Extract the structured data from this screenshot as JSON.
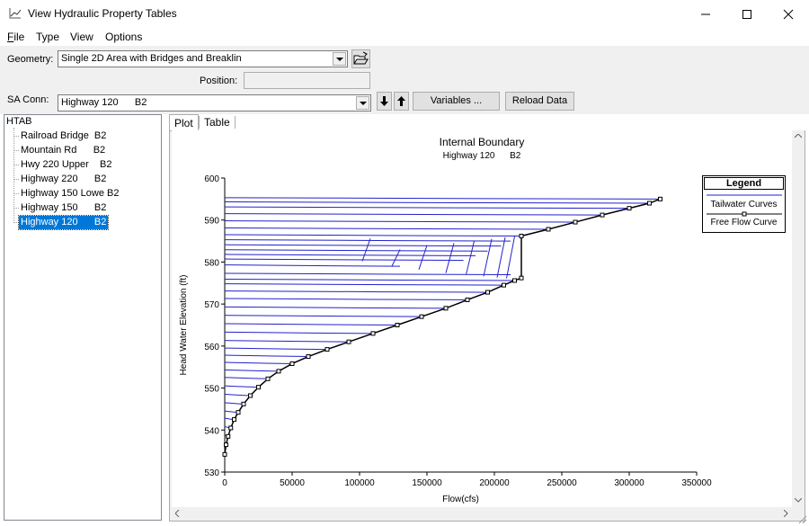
{
  "window": {
    "title": "View Hydraulic Property Tables",
    "icons": [
      "app-chart-icon",
      "minimize-icon",
      "maximize-icon",
      "close-icon"
    ]
  },
  "menu": {
    "file": {
      "u": "F",
      "rest": "ile"
    },
    "type": "Type",
    "view": "View",
    "options": "Options"
  },
  "toolbar": {
    "geometry_label": "Geometry:",
    "geometry_value": "Single 2D Area with Bridges and Breaklin",
    "position_label": "Position:",
    "position_value": "",
    "saconn_label": "SA Conn:",
    "saconn_value": "Highway 120      B2",
    "variables_button": "Variables ...",
    "reload_button": "Reload Data",
    "icons": [
      "open-folder-icon",
      "down-arrow-icon",
      "up-arrow-icon"
    ]
  },
  "tree": {
    "root": "HTAB",
    "items": [
      {
        "label": "Railroad Bridge  B2",
        "selected": false
      },
      {
        "label": "Mountain Rd      B2",
        "selected": false
      },
      {
        "label": "Hwy 220 Upper    B2",
        "selected": false
      },
      {
        "label": "Highway 220      B2",
        "selected": false
      },
      {
        "label": "Highway 150 Lowe B2",
        "selected": false
      },
      {
        "label": "Highway 150      B2",
        "selected": false
      },
      {
        "label": "Highway 120      B2",
        "selected": true
      }
    ]
  },
  "tabs": [
    {
      "label": "Plot",
      "active": true
    },
    {
      "label": "Table",
      "active": false
    }
  ],
  "chart_data": {
    "type": "line",
    "title": "Internal Boundary",
    "subtitle": "Highway 120      B2",
    "xlabel": "Flow(cfs)",
    "ylabel": "Head Water Elevation (ft)",
    "xlim": [
      0,
      350000
    ],
    "ylim": [
      530,
      600
    ],
    "xticks": [
      "0",
      "50000",
      "100000",
      "150000",
      "200000",
      "250000",
      "300000",
      "350000"
    ],
    "yticks": [
      "530",
      "540",
      "550",
      "560",
      "570",
      "580",
      "590",
      "600"
    ],
    "legend_position": "top-right",
    "legend_title": "Legend",
    "colors": {
      "tailwater": "#2222cc",
      "freeflow": "#000000"
    },
    "series": [
      {
        "name": "Free Flow Curve",
        "points": [
          [
            0,
            534.2
          ],
          [
            1000,
            536.5
          ],
          [
            2500,
            538.5
          ],
          [
            4500,
            540.5
          ],
          [
            7000,
            542.5
          ],
          [
            10000,
            544.2
          ],
          [
            14000,
            546.2
          ],
          [
            19000,
            548.2
          ],
          [
            25000,
            550.2
          ],
          [
            32000,
            552.2
          ],
          [
            40000,
            554.0
          ],
          [
            50000,
            555.8
          ],
          [
            62000,
            557.5
          ],
          [
            76000,
            559.2
          ],
          [
            92000,
            561.0
          ],
          [
            110000,
            563.0
          ],
          [
            128000,
            565.0
          ],
          [
            146000,
            567.0
          ],
          [
            164000,
            569.0
          ],
          [
            180000,
            571.0
          ],
          [
            195000,
            572.8
          ],
          [
            207000,
            574.5
          ],
          [
            215000,
            575.6
          ],
          [
            220000,
            576.2
          ],
          [
            220000,
            586.2
          ],
          [
            240000,
            587.8
          ],
          [
            260000,
            589.5
          ],
          [
            280000,
            591.2
          ],
          [
            300000,
            592.8
          ],
          [
            315000,
            594.0
          ],
          [
            323000,
            595.0
          ]
        ]
      },
      {
        "name": "Tailwater Curves",
        "curves": [
          {
            "head": 595.0,
            "x0": 0,
            "x1": 323000
          },
          {
            "head": 594.0,
            "x0": 0,
            "x1": 315000
          },
          {
            "head": 592.8,
            "x0": 0,
            "x1": 300000
          },
          {
            "head": 591.2,
            "x0": 0,
            "x1": 280000
          },
          {
            "head": 589.5,
            "x0": 0,
            "x1": 260000
          },
          {
            "head": 587.8,
            "x0": 0,
            "x1": 240000
          },
          {
            "head": 586.2,
            "x0": 0,
            "x1": 220000
          },
          {
            "head": 585.0,
            "x0": 0,
            "x1": 212000
          },
          {
            "head": 583.8,
            "x0": 0,
            "x1": 205000
          },
          {
            "head": 582.6,
            "x0": 0,
            "x1": 195000
          },
          {
            "head": 581.5,
            "x0": 0,
            "x1": 186000
          },
          {
            "head": 580.4,
            "x0": 0,
            "x1": 177000
          },
          {
            "head": 579.0,
            "x0": 0,
            "x1": 130000
          },
          {
            "head": 577.0,
            "x0": 0,
            "x1": 212000
          },
          {
            "head": 575.6,
            "x0": 0,
            "x1": 215000
          },
          {
            "head": 574.5,
            "x0": 0,
            "x1": 207000
          },
          {
            "head": 572.8,
            "x0": 0,
            "x1": 195000
          },
          {
            "head": 571.0,
            "x0": 0,
            "x1": 180000
          },
          {
            "head": 569.0,
            "x0": 0,
            "x1": 164000
          },
          {
            "head": 567.0,
            "x0": 0,
            "x1": 146000
          },
          {
            "head": 565.0,
            "x0": 0,
            "x1": 128000
          },
          {
            "head": 563.0,
            "x0": 0,
            "x1": 110000
          },
          {
            "head": 561.0,
            "x0": 0,
            "x1": 92000
          },
          {
            "head": 559.2,
            "x0": 0,
            "x1": 76000
          },
          {
            "head": 557.5,
            "x0": 0,
            "x1": 62000
          },
          {
            "head": 555.8,
            "x0": 0,
            "x1": 50000
          },
          {
            "head": 554.0,
            "x0": 0,
            "x1": 40000
          },
          {
            "head": 552.2,
            "x0": 0,
            "x1": 32000
          },
          {
            "head": 550.2,
            "x0": 0,
            "x1": 25000
          },
          {
            "head": 548.2,
            "x0": 0,
            "x1": 19000
          },
          {
            "head": 546.2,
            "x0": 0,
            "x1": 14000
          },
          {
            "head": 544.2,
            "x0": 0,
            "x1": 10000
          },
          {
            "head": 542.5,
            "x0": 0,
            "x1": 7000
          },
          {
            "head": 540.5,
            "x0": 0,
            "x1": 4500
          },
          {
            "head": 538.5,
            "x0": 0,
            "x1": 2500
          }
        ]
      }
    ]
  }
}
